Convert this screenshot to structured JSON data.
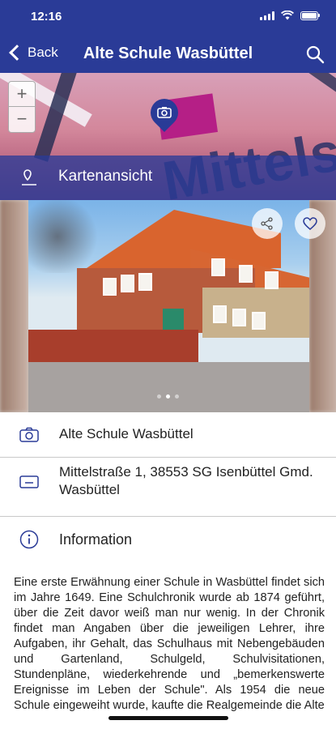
{
  "status_bar": {
    "time": "12:16"
  },
  "nav": {
    "back_label": "Back",
    "title": "Alte Schule Wasbüttel",
    "search_icon": "search-icon"
  },
  "map": {
    "street_label": "Mittelstr",
    "view_label": "Kartenansicht",
    "zoom_in": "+",
    "zoom_out": "−"
  },
  "gallery": {
    "image_count": 3,
    "active_index": 1
  },
  "details": {
    "name": "Alte Schule Wasbüttel",
    "address_line1": "Mittelstraße 1, 38553 SG Isenbüttel Gmd.",
    "address_line2": "Wasbüttel",
    "info_heading": "Information",
    "info_text": "Eine erste Erwähnung einer Schule in Wasbüttel findet sich im Jahre 1649. Eine Schulchronik wurde ab 1874 geführt, über die Zeit davor weiß man nur wenig. In der Chronik findet man Angaben über die jeweiligen Lehrer, ihre Aufgaben, ihr Gehalt, das Schulhaus mit Nebengebäuden und Gartenland, Schulgeld, Schulvisitationen, Stundenpläne, wiederkehrende und „bemerkenswerte Ereignisse im Leben der Schule\". Als 1954 die neue Schule eingeweiht wurde, kaufte die Realgemeinde die Alte"
  },
  "colors": {
    "brand": "#2a3b97",
    "icon": "#2a3b97"
  }
}
